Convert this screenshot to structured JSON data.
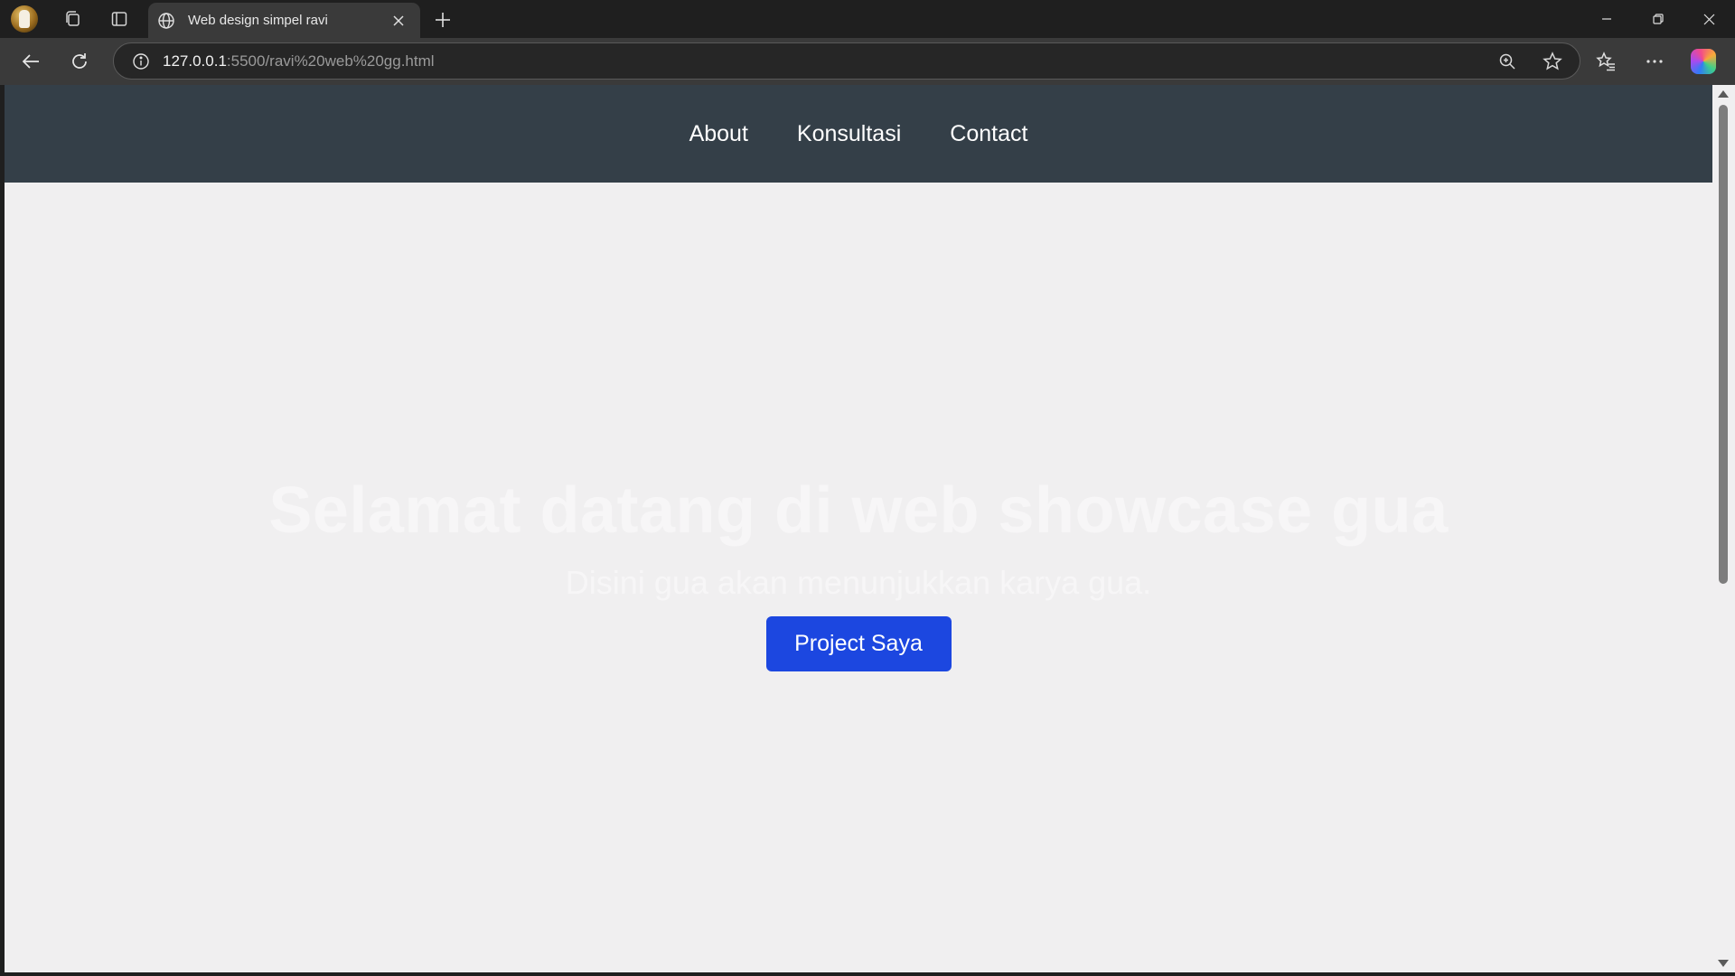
{
  "browser": {
    "tab_title": "Web design simpel ravi",
    "url_host": "127.0.0.1",
    "url_rest": ":5500/ravi%20web%20gg.html",
    "icons": [
      "profile-avatar",
      "collections-icon",
      "tab-actions-icon",
      "globe-icon",
      "close-icon",
      "plus-icon",
      "minimize-icon",
      "restore-icon",
      "window-close-icon",
      "back-arrow-icon",
      "reload-icon",
      "info-icon",
      "zoom-icon",
      "star-icon",
      "favorites-icon",
      "more-icon",
      "copilot-icon"
    ]
  },
  "site": {
    "nav": [
      "About",
      "Konsultasi",
      "Contact"
    ],
    "hero_title": "Selamat datang di web showcase gua",
    "hero_subtitle": "Disini gua akan menunjukkan karya gua.",
    "hero_button": "Project Saya"
  },
  "colors": {
    "nav_bg": "#343f48",
    "page_bg": "#f0eff0",
    "button_bg": "#1c47e0"
  }
}
